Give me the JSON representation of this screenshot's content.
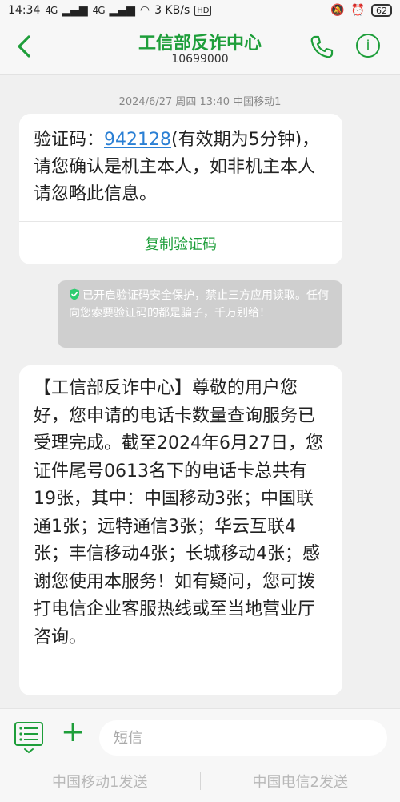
{
  "status_bar": {
    "time": "14:34",
    "signal_1": "4G",
    "signal_2": "4G",
    "speed": "3 KB/s",
    "hd_label": "HD",
    "battery": "62"
  },
  "header": {
    "title": "工信部反诈中心",
    "number": "10699000",
    "accent_color": "#1e9e3a"
  },
  "conversation": {
    "timestamp": "2024/6/27 周四 13:40  中国移动1",
    "message1": {
      "prefix": "验证码：",
      "code": "942128",
      "suffix": "(有效期为5分钟)，请您确认是机主本人，如非机主本人请忽略此信息。",
      "copy_label": "复制验证码"
    },
    "security_notice": "已开启验证码安全保护，禁止三方应用读取。任何向您索要验证码的都是骗子，千万别给！",
    "message2": "【工信部反诈中心】尊敬的用户您好，您申请的电话卡数量查询服务已受理完成。截至2024年6月27日，您证件尾号0613名下的电话卡总共有19张，其中：中国移动3张；中国联通1张；远特通信3张；华云互联4张；丰信移动4张；长城移动4张；感谢您使用本服务！如有疑问，您可拨打电信企业客服热线或至当地营业厅咨询。"
  },
  "composer": {
    "placeholder": "短信",
    "send_sim1": "中国移动1发送",
    "send_sim2": "中国电信2发送"
  }
}
